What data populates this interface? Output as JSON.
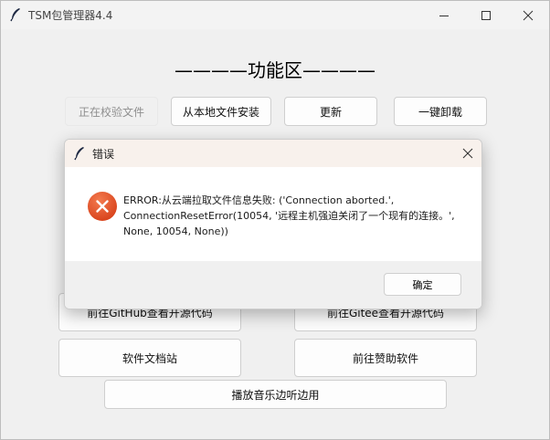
{
  "window": {
    "title": "TSM包管理器4.4"
  },
  "main": {
    "heading": "————功能区————",
    "toolbar": [
      {
        "label": "正在校验文件",
        "disabled": true
      },
      {
        "label": "从本地文件安装",
        "disabled": false
      },
      {
        "label": "更新",
        "disabled": false
      },
      {
        "label": "一键卸载",
        "disabled": false
      }
    ],
    "links": {
      "github": "前往GitHub查看开源代码",
      "gitee": "前往Gitee查看开源代码",
      "docs": "软件文档站",
      "sponsor": "前往赞助软件",
      "music": "播放音乐边听边用"
    }
  },
  "dialog": {
    "title": "错误",
    "message": "ERROR:从云端拉取文件信息失败: ('Connection aborted.', ConnectionResetError(10054, '远程主机强迫关闭了一个现有的连接。', None, 10054, None))",
    "ok_label": "确定",
    "icon": "error-icon"
  },
  "colors": {
    "error_icon": "#e0532a",
    "dialog_titlebar": "#f8f1ec"
  }
}
